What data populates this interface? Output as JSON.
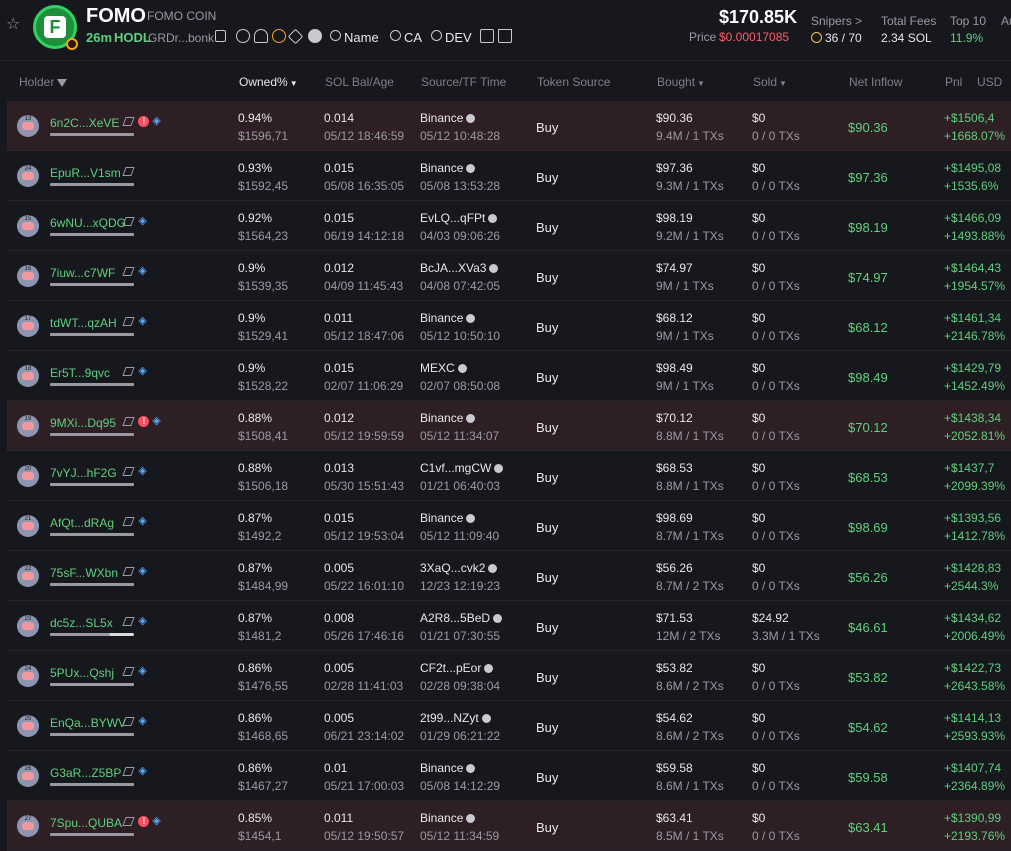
{
  "header": {
    "token_name": "FOMO",
    "token_fullname": "FOMO COIN",
    "age": "26m",
    "hodl_label": "HODL",
    "address": "GRDr...bonk",
    "search_name": "Name",
    "search_ca": "CA",
    "search_dev": "DEV",
    "market_cap": "$170.85K",
    "price_label": "Price",
    "price_value": "$0.00017085",
    "snipers_label": "Snipers >",
    "snipers_value": "36 / 70",
    "total_fees_label": "Total Fees",
    "total_fees_value": "2.34 SOL",
    "top10_label": "Top 10",
    "top10_value": "11.9%",
    "extra_label": "Au"
  },
  "columns": {
    "holder": "Holder",
    "owned": "Owned%",
    "sol_bal": "SOL Bal/Age",
    "source": "Source/TF Time",
    "token_source": "Token Source",
    "bought": "Bought",
    "sold": "Sold",
    "net_inflow": "Net Inflow",
    "pnl": "Pnl",
    "usd": "USD"
  },
  "colors": {
    "accent_green": "#5fd07e",
    "red": "#ff5c6a",
    "highlight_row": "#2e1f25"
  },
  "rows": [
    {
      "level": "13",
      "addr": "6n2C...XeVE",
      "red": true,
      "blue": true,
      "hl": true,
      "bar": 1,
      "owned": "0.94%",
      "owned_usd": "$1596,71",
      "sol": "0.014",
      "age": "05/12 18:46:59",
      "source": "Binance",
      "tf_time": "05/12 10:48:28",
      "token_source": "Buy",
      "bought": "$90.36",
      "bought_sub": "9.4M / 1 TXs",
      "sold": "$0",
      "sold_sub": "0 / 0 TXs",
      "net": "$90.36",
      "pnl": "+$1506,4",
      "pnl_pct": "+1668.07%"
    },
    {
      "level": "24",
      "addr": "EpuR...V1sm",
      "red": false,
      "blue": false,
      "hl": false,
      "bar": 1,
      "owned": "0.93%",
      "owned_usd": "$1592,45",
      "sol": "0.015",
      "age": "05/08 16:35:05",
      "source": "Binance",
      "tf_time": "05/08 13:53:28",
      "token_source": "Buy",
      "bought": "$97.36",
      "bought_sub": "9.3M / 1 TXs",
      "sold": "$0",
      "sold_sub": "0 / 0 TXs",
      "net": "$97.36",
      "pnl": "+$1495,08",
      "pnl_pct": "+1535.6%"
    },
    {
      "level": "15",
      "addr": "6wNU...xQDG",
      "red": false,
      "blue": true,
      "hl": false,
      "bar": 1,
      "owned": "0.92%",
      "owned_usd": "$1564,23",
      "sol": "0.015",
      "age": "06/19 14:12:18",
      "source": "EvLQ...qFPt",
      "tf_time": "04/03 09:06:26",
      "token_source": "Buy",
      "bought": "$98.19",
      "bought_sub": "9.2M / 1 TXs",
      "sold": "$0",
      "sold_sub": "0 / 0 TXs",
      "net": "$98.19",
      "pnl": "+$1466,09",
      "pnl_pct": "+1493.88%"
    },
    {
      "level": "16",
      "addr": "7iuw...c7WF",
      "red": false,
      "blue": true,
      "hl": false,
      "bar": 1,
      "owned": "0.9%",
      "owned_usd": "$1539,35",
      "sol": "0.012",
      "age": "04/09 11:45:43",
      "source": "BcJA...XVa3",
      "tf_time": "04/08 07:42:05",
      "token_source": "Buy",
      "bought": "$74.97",
      "bought_sub": "9M / 1 TXs",
      "sold": "$0",
      "sold_sub": "0 / 0 TXs",
      "net": "$74.97",
      "pnl": "+$1464,43",
      "pnl_pct": "+1954.57%"
    },
    {
      "level": "17",
      "addr": "tdWT...qzAH",
      "red": false,
      "blue": true,
      "hl": false,
      "bar": 1,
      "owned": "0.9%",
      "owned_usd": "$1529,41",
      "sol": "0.011",
      "age": "05/12 18:47:06",
      "source": "Binance",
      "tf_time": "05/12 10:50:10",
      "token_source": "Buy",
      "bought": "$68.12",
      "bought_sub": "9M / 1 TXs",
      "sold": "$0",
      "sold_sub": "0 / 0 TXs",
      "net": "$68.12",
      "pnl": "+$1461,34",
      "pnl_pct": "+2146.78%"
    },
    {
      "level": "18",
      "addr": "Er5T...9qvc",
      "red": false,
      "blue": true,
      "hl": false,
      "bar": 1,
      "owned": "0.9%",
      "owned_usd": "$1528,22",
      "sol": "0.015",
      "age": "02/07 11:06:29",
      "source": "MEXC",
      "tf_time": "02/07 08:50:08",
      "token_source": "Buy",
      "bought": "$98.49",
      "bought_sub": "9M / 1 TXs",
      "sold": "$0",
      "sold_sub": "0 / 0 TXs",
      "net": "$98.49",
      "pnl": "+$1429,79",
      "pnl_pct": "+1452.49%"
    },
    {
      "level": "19",
      "addr": "9MXi...Dq95",
      "red": true,
      "blue": true,
      "hl": true,
      "bar": 1,
      "owned": "0.88%",
      "owned_usd": "$1508,41",
      "sol": "0.012",
      "age": "05/12 19:59:59",
      "source": "Binance",
      "tf_time": "05/12 11:34:07",
      "token_source": "Buy",
      "bought": "$70.12",
      "bought_sub": "8.8M / 1 TXs",
      "sold": "$0",
      "sold_sub": "0 / 0 TXs",
      "net": "$70.12",
      "pnl": "+$1438,34",
      "pnl_pct": "+2052.81%"
    },
    {
      "level": "20",
      "addr": "7vYJ...hF2G",
      "red": false,
      "blue": true,
      "hl": false,
      "bar": 1,
      "owned": "0.88%",
      "owned_usd": "$1506,18",
      "sol": "0.013",
      "age": "05/30 15:51:43",
      "source": "C1vf...mgCW",
      "tf_time": "01/21 06:40:03",
      "token_source": "Buy",
      "bought": "$68.53",
      "bought_sub": "8.8M / 1 TXs",
      "sold": "$0",
      "sold_sub": "0 / 0 TXs",
      "net": "$68.53",
      "pnl": "+$1437,7",
      "pnl_pct": "+2099.39%"
    },
    {
      "level": "21",
      "addr": "AfQt...dRAg",
      "red": false,
      "blue": true,
      "hl": false,
      "bar": 1,
      "owned": "0.87%",
      "owned_usd": "$1492,2",
      "sol": "0.015",
      "age": "05/12 19:53:04",
      "source": "Binance",
      "tf_time": "05/12 11:09:40",
      "token_source": "Buy",
      "bought": "$98.69",
      "bought_sub": "8.7M / 1 TXs",
      "sold": "$0",
      "sold_sub": "0 / 0 TXs",
      "net": "$98.69",
      "pnl": "+$1393,56",
      "pnl_pct": "+1412.78%"
    },
    {
      "level": "22",
      "addr": "75sF...WXbn",
      "red": false,
      "blue": true,
      "hl": false,
      "bar": 1,
      "owned": "0.87%",
      "owned_usd": "$1484,99",
      "sol": "0.005",
      "age": "05/22 16:01:10",
      "source": "3XaQ...cvk2",
      "tf_time": "12/23 12:19:23",
      "token_source": "Buy",
      "bought": "$56.26",
      "bought_sub": "8.7M / 2 TXs",
      "sold": "$0",
      "sold_sub": "0 / 0 TXs",
      "net": "$56.26",
      "pnl": "+$1428,83",
      "pnl_pct": "+2544.3%"
    },
    {
      "level": "23",
      "addr": "dc5z...SL5x",
      "red": false,
      "blue": true,
      "hl": false,
      "bar": 0.72,
      "owned": "0.87%",
      "owned_usd": "$1481,2",
      "sol": "0.008",
      "age": "05/26 17:46:16",
      "source": "A2R8...5BeD",
      "tf_time": "01/21 07:30:55",
      "token_source": "Buy",
      "bought": "$71.53",
      "bought_sub": "12M / 2 TXs",
      "sold": "$24.92",
      "sold_sub": "3.3M / 1 TXs",
      "net": "$46.61",
      "pnl": "+$1434,62",
      "pnl_pct": "+2006.49%"
    },
    {
      "level": "24",
      "addr": "5PUx...Qshj",
      "red": false,
      "blue": true,
      "hl": false,
      "bar": 1,
      "owned": "0.86%",
      "owned_usd": "$1476,55",
      "sol": "0.005",
      "age": "02/28 11:41:03",
      "source": "CF2t...pEor",
      "tf_time": "02/28 09:38:04",
      "token_source": "Buy",
      "bought": "$53.82",
      "bought_sub": "8.6M / 2 TXs",
      "sold": "$0",
      "sold_sub": "0 / 0 TXs",
      "net": "$53.82",
      "pnl": "+$1422,73",
      "pnl_pct": "+2643.58%"
    },
    {
      "level": "25",
      "addr": "EnQa...BYWV",
      "red": false,
      "blue": true,
      "hl": false,
      "bar": 1,
      "owned": "0.86%",
      "owned_usd": "$1468,65",
      "sol": "0.005",
      "age": "06/21 23:14:02",
      "source": "2t99...NZyt",
      "tf_time": "01/29 06:21:22",
      "token_source": "Buy",
      "bought": "$54.62",
      "bought_sub": "8.6M / 2 TXs",
      "sold": "$0",
      "sold_sub": "0 / 0 TXs",
      "net": "$54.62",
      "pnl": "+$1414,13",
      "pnl_pct": "+2593.93%"
    },
    {
      "level": "26",
      "addr": "G3aR...Z5BP",
      "red": false,
      "blue": true,
      "hl": false,
      "bar": 1,
      "owned": "0.86%",
      "owned_usd": "$1467,27",
      "sol": "0.01",
      "age": "05/21 17:00:03",
      "source": "Binance",
      "tf_time": "05/08 14:12:29",
      "token_source": "Buy",
      "bought": "$59.58",
      "bought_sub": "8.6M / 1 TXs",
      "sold": "$0",
      "sold_sub": "0 / 0 TXs",
      "net": "$59.58",
      "pnl": "+$1407,74",
      "pnl_pct": "+2364.89%"
    },
    {
      "level": "27",
      "addr": "7Spu...QUBA",
      "red": true,
      "blue": true,
      "hl": true,
      "bar": 1,
      "owned": "0.85%",
      "owned_usd": "$1454,1",
      "sol": "0.011",
      "age": "05/12 19:50:57",
      "source": "Binance",
      "tf_time": "05/12 11:34:59",
      "token_source": "Buy",
      "bought": "$63.41",
      "bought_sub": "8.5M / 1 TXs",
      "sold": "$0",
      "sold_sub": "0 / 0 TXs",
      "net": "$63.41",
      "pnl": "+$1390,99",
      "pnl_pct": "+2193.76%"
    }
  ]
}
